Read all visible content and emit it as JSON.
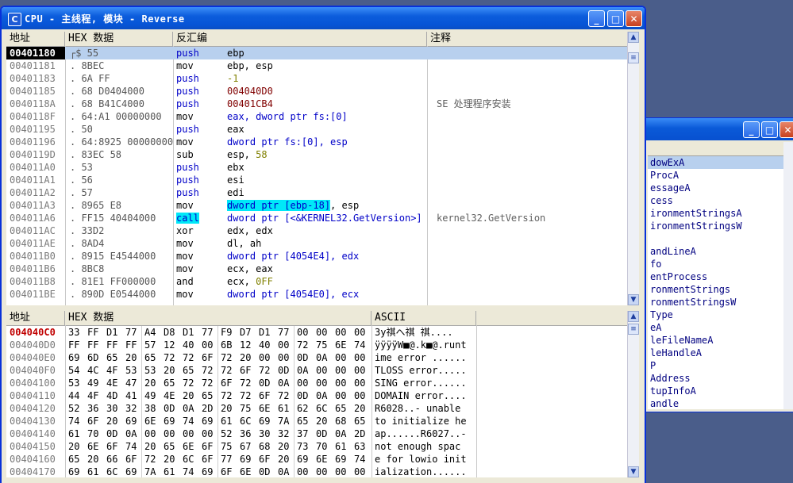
{
  "main_window": {
    "title": "CPU - 主线程, 模块 - Reverse",
    "buttons": {
      "minimize": "_",
      "maximize": "□",
      "close": "✕"
    }
  },
  "disasm": {
    "headers": {
      "address": "地址",
      "hex": "HEX 数据",
      "disasm": "反汇编",
      "comment": "注释"
    },
    "rows": [
      {
        "addr": "00401180",
        "mark": "┌$",
        "hex": "55",
        "mn": "push",
        "op": "ebp",
        "cmt": "",
        "cur": true
      },
      {
        "addr": "00401181",
        "mark": ".",
        "hex": "8BEC",
        "mn": "mov",
        "op": "ebp, esp",
        "cmt": ""
      },
      {
        "addr": "00401183",
        "mark": ".",
        "hex": "6A FF",
        "mn": "push",
        "op": "-1",
        "cmt": ""
      },
      {
        "addr": "00401185",
        "mark": ".",
        "hex": "68 D0404000",
        "mn": "push",
        "op": "004040D0",
        "cmt": ""
      },
      {
        "addr": "0040118A",
        "mark": ".",
        "hex": "68 B41C4000",
        "mn": "push",
        "op": "00401CB4",
        "cmt": "SE 处理程序安装"
      },
      {
        "addr": "0040118F",
        "mark": ".",
        "hex": "64:A1 00000000",
        "mn": "mov",
        "op": "eax, dword ptr fs:[0]",
        "cmt": ""
      },
      {
        "addr": "00401195",
        "mark": ".",
        "hex": "50",
        "mn": "push",
        "op": "eax",
        "cmt": ""
      },
      {
        "addr": "00401196",
        "mark": ".",
        "hex": "64:8925 00000000",
        "mn": "mov",
        "op": "dword ptr fs:[0], esp",
        "cmt": ""
      },
      {
        "addr": "0040119D",
        "mark": ".",
        "hex": "83EC 58",
        "mn": "sub",
        "op": "esp, 58",
        "cmt": ""
      },
      {
        "addr": "004011A0",
        "mark": ".",
        "hex": "53",
        "mn": "push",
        "op": "ebx",
        "cmt": ""
      },
      {
        "addr": "004011A1",
        "mark": ".",
        "hex": "56",
        "mn": "push",
        "op": "esi",
        "cmt": ""
      },
      {
        "addr": "004011A2",
        "mark": ".",
        "hex": "57",
        "mn": "push",
        "op": "edi",
        "cmt": ""
      },
      {
        "addr": "004011A3",
        "mark": ".",
        "hex": "8965 E8",
        "mn": "mov",
        "op": "dword ptr [ebp-18]",
        "op2": ", esp",
        "cmt": ""
      },
      {
        "addr": "004011A6",
        "mark": ".",
        "hex": "FF15 40404000",
        "mn": "call",
        "op": "dword ptr [<&KERNEL32.GetVersion>]",
        "cmt": "kernel32.GetVersion"
      },
      {
        "addr": "004011AC",
        "mark": ".",
        "hex": "33D2",
        "mn": "xor",
        "op": "edx, edx",
        "cmt": ""
      },
      {
        "addr": "004011AE",
        "mark": ".",
        "hex": "8AD4",
        "mn": "mov",
        "op": "dl, ah",
        "cmt": ""
      },
      {
        "addr": "004011B0",
        "mark": ".",
        "hex": "8915 E4544000",
        "mn": "mov",
        "op": "dword ptr [4054E4], edx",
        "cmt": ""
      },
      {
        "addr": "004011B6",
        "mark": ".",
        "hex": "8BC8",
        "mn": "mov",
        "op": "ecx, eax",
        "cmt": ""
      },
      {
        "addr": "004011B8",
        "mark": ".",
        "hex": "81E1 FF000000",
        "mn": "and",
        "op": "ecx, 0FF",
        "cmt": ""
      },
      {
        "addr": "004011BE",
        "mark": ".",
        "hex": "890D E0544000",
        "mn": "mov",
        "op": "dword ptr [4054E0], ecx",
        "cmt": ""
      }
    ]
  },
  "dump": {
    "headers": {
      "address": "地址",
      "hex": "HEX 数据",
      "ascii": "ASCII"
    },
    "rows": [
      {
        "addr": "004040C0",
        "bytes": [
          "33",
          "FF",
          "D1",
          "77",
          "A4",
          "D8",
          "D1",
          "77",
          "F9",
          "D7",
          "D1",
          "77",
          "00",
          "00",
          "00",
          "00"
        ],
        "ascii": "3y祺へ祺  祺....",
        "cur": true
      },
      {
        "addr": "004040D0",
        "bytes": [
          "FF",
          "FF",
          "FF",
          "FF",
          "57",
          "12",
          "40",
          "00",
          "6B",
          "12",
          "40",
          "00",
          "72",
          "75",
          "6E",
          "74"
        ],
        "ascii": "ÿÿÿÿW■@.k■@.runt"
      },
      {
        "addr": "004040E0",
        "bytes": [
          "69",
          "6D",
          "65",
          "20",
          "65",
          "72",
          "72",
          "6F",
          "72",
          "20",
          "00",
          "00",
          "0D",
          "0A",
          "00",
          "00"
        ],
        "ascii": "ime error ......"
      },
      {
        "addr": "004040F0",
        "bytes": [
          "54",
          "4C",
          "4F",
          "53",
          "53",
          "20",
          "65",
          "72",
          "72",
          "6F",
          "72",
          "0D",
          "0A",
          "00",
          "00",
          "00"
        ],
        "ascii": "TLOSS error....."
      },
      {
        "addr": "00404100",
        "bytes": [
          "53",
          "49",
          "4E",
          "47",
          "20",
          "65",
          "72",
          "72",
          "6F",
          "72",
          "0D",
          "0A",
          "00",
          "00",
          "00",
          "00"
        ],
        "ascii": "SING error......"
      },
      {
        "addr": "00404110",
        "bytes": [
          "44",
          "4F",
          "4D",
          "41",
          "49",
          "4E",
          "20",
          "65",
          "72",
          "72",
          "6F",
          "72",
          "0D",
          "0A",
          "00",
          "00"
        ],
        "ascii": "DOMAIN error...."
      },
      {
        "addr": "00404120",
        "bytes": [
          "52",
          "36",
          "30",
          "32",
          "38",
          "0D",
          "0A",
          "2D",
          "20",
          "75",
          "6E",
          "61",
          "62",
          "6C",
          "65",
          "20"
        ],
        "ascii": "R6028..- unable "
      },
      {
        "addr": "00404130",
        "bytes": [
          "74",
          "6F",
          "20",
          "69",
          "6E",
          "69",
          "74",
          "69",
          "61",
          "6C",
          "69",
          "7A",
          "65",
          "20",
          "68",
          "65"
        ],
        "ascii": "to initialize he"
      },
      {
        "addr": "00404140",
        "bytes": [
          "61",
          "70",
          "0D",
          "0A",
          "00",
          "00",
          "00",
          "00",
          "52",
          "36",
          "30",
          "32",
          "37",
          "0D",
          "0A",
          "2D"
        ],
        "ascii": "ap......R6027..-"
      },
      {
        "addr": "00404150",
        "bytes": [
          "20",
          "6E",
          "6F",
          "74",
          "20",
          "65",
          "6E",
          "6F",
          "75",
          "67",
          "68",
          "20",
          "73",
          "70",
          "61",
          "63"
        ],
        "ascii": " not enough spac"
      },
      {
        "addr": "00404160",
        "bytes": [
          "65",
          "20",
          "66",
          "6F",
          "72",
          "20",
          "6C",
          "6F",
          "77",
          "69",
          "6F",
          "20",
          "69",
          "6E",
          "69",
          "74"
        ],
        "ascii": "e for lowio init"
      },
      {
        "addr": "00404170",
        "bytes": [
          "69",
          "61",
          "6C",
          "69",
          "7A",
          "61",
          "74",
          "69",
          "6F",
          "6E",
          "0D",
          "0A",
          "00",
          "00",
          "00",
          "00"
        ],
        "ascii": "ialization......"
      }
    ]
  },
  "bg_window": {
    "items": [
      "dowExA",
      "ProcA",
      "essageA",
      "cess",
      "ironmentStringsA",
      "ironmentStringsW",
      "",
      "andLineA",
      "fo",
      "entProcess",
      "ronmentStrings",
      "ronmentStringsW",
      "Type",
      "eA",
      "leFileNameA",
      "leHandleA",
      "P",
      "Address",
      "tupInfoA",
      "andle"
    ]
  },
  "colors": {
    "cur_addr_bg": "#000000",
    "dump_addr": "#c00000",
    "highlight": "#00e8f8",
    "keyword_blue": "#0000c8"
  }
}
